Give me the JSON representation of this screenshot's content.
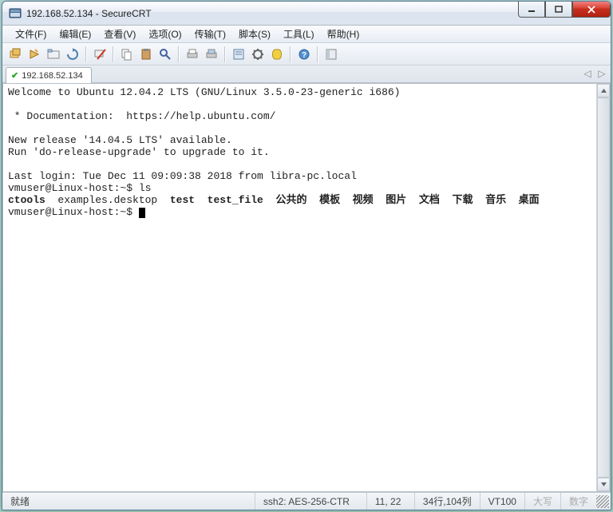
{
  "window": {
    "title": "192.168.52.134 - SecureCRT"
  },
  "menu": {
    "file": "文件(F)",
    "edit": "编辑(E)",
    "view": "查看(V)",
    "options": "选项(O)",
    "transfer": "传输(T)",
    "script": "脚本(S)",
    "tools": "工具(L)",
    "help": "帮助(H)"
  },
  "tabs": {
    "active": "192.168.52.134"
  },
  "terminal": {
    "line1": "Welcome to Ubuntu 12.04.2 LTS (GNU/Linux 3.5.0-23-generic i686)",
    "doc": " * Documentation:  https://help.ubuntu.com/",
    "rel1": "New release '14.04.5 LTS' available.",
    "rel2": "Run 'do-release-upgrade' to upgrade to it.",
    "last": "Last login: Tue Dec 11 09:09:38 2018 from libra-pc.local",
    "ps1": "vmuser@Linux-host:~$ ",
    "cmd1": "ls",
    "ls_bold1": "ctools",
    "ls_plain": "  examples.desktop  ",
    "ls_bold2": "test  test_file  公共的  模板  视频  图片  文档  下载  音乐  桌面"
  },
  "status": {
    "ready": "就绪",
    "cipher": "ssh2: AES-256-CTR",
    "pos": "11, 22",
    "size": "34行,104列",
    "term": "VT100",
    "caps": "大写",
    "num": "数字"
  }
}
